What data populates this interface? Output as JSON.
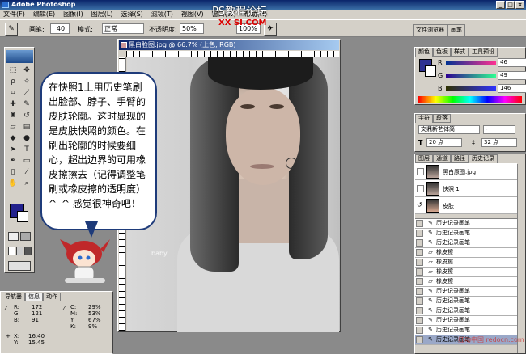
{
  "app": {
    "title": "Adobe Photoshop",
    "min": "_",
    "max": "□",
    "close": "×"
  },
  "watermark": {
    "line1": "PS教程论坛",
    "line2": "XX SI.COM"
  },
  "menu": [
    "文件(F)",
    "编辑(E)",
    "图像(I)",
    "图层(L)",
    "选择(S)",
    "滤镜(T)",
    "视图(V)",
    "窗口(W)",
    "帮助(H)"
  ],
  "options": {
    "brush_label": "画笔:",
    "brush_size": "40",
    "mode_label": "模式:",
    "mode_value": "正常",
    "opacity_label": "不透明度:",
    "opacity_value": "50%",
    "flow_value": "100%"
  },
  "palette_tabs": [
    "文件浏览器",
    "画笔"
  ],
  "document": {
    "title": "黑白脸图.jpg @ 66.7% (上色, RGB)"
  },
  "bubble": {
    "text": "在快照1上用历史笔刷出脸部、脖子、手臂的皮肤轮廓。这时显现的是皮肤快照的颜色。在刷出轮廓的时候要细心，超出边界的可用橡皮擦擦去（记得调整笔刷或橡皮擦的透明度）^_^ 感觉很神奇吧！"
  },
  "color_panel": {
    "tabs": [
      "颜色",
      "色板",
      "样式",
      "工具预设"
    ],
    "r_label": "R",
    "r": "46",
    "g_label": "G",
    "g": "49",
    "b_label": "B",
    "b": "146",
    "fg_color": "#2e3192"
  },
  "char_panel": {
    "tabs": [
      "字符",
      "段落"
    ],
    "font": "文鼎新艺体简",
    "style": "-",
    "size": "20 点",
    "leading": "32 点"
  },
  "history_panel": {
    "tabs": [
      "图层",
      "通道",
      "路径",
      "历史记录"
    ],
    "snapshots": [
      {
        "name": "黑白原图.jpg"
      },
      {
        "name": "快照 1"
      },
      {
        "name": "皮肤"
      }
    ],
    "states": [
      "历史记录画笔",
      "历史记录画笔",
      "历史记录画笔",
      "橡皮擦",
      "橡皮擦",
      "橡皮擦",
      "橡皮擦",
      "历史记录画笔",
      "历史记录画笔",
      "历史记录画笔",
      "历史记录画笔",
      "历史记录画笔",
      "历史记录画笔"
    ]
  },
  "nav_panel": {
    "tabs": [
      "导航器",
      "信息",
      "动作"
    ],
    "R_label": "R:",
    "R": "172",
    "G_label": "G:",
    "G": "121",
    "B_label": "B:",
    "B": "91",
    "C_label": "C:",
    "C": "29%",
    "M_label": "M:",
    "M": "53%",
    "Y_label": "Y:",
    "Y": "67%",
    "K_label": "K:",
    "K": "9%",
    "X_label": "X:",
    "X": "16.40",
    "Ycoord_label": "Y:",
    "Ycoord": "15.45"
  },
  "photo_watermark": "baby",
  "site_watermark": "红动中国 redocn.com"
}
